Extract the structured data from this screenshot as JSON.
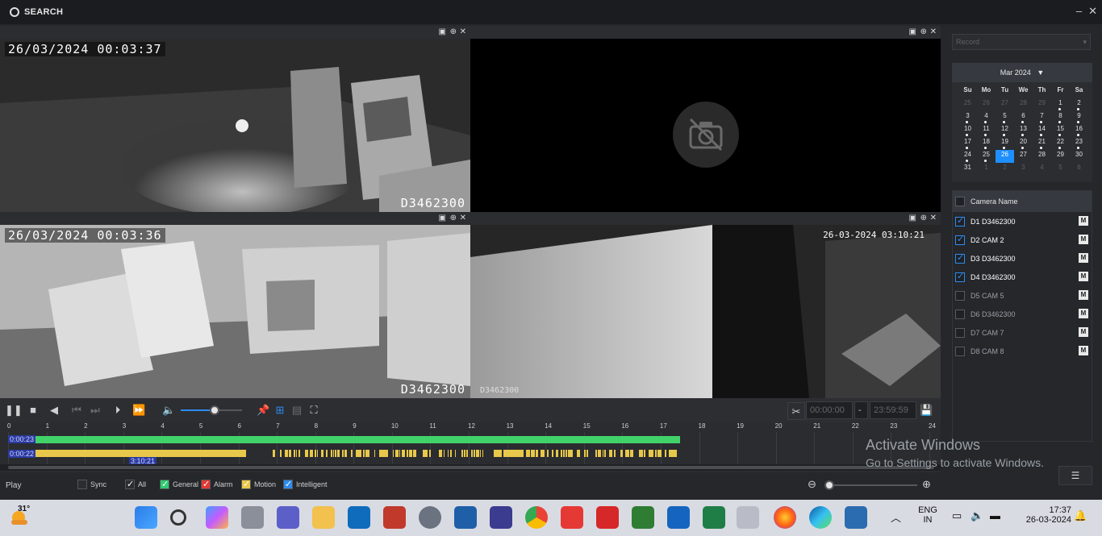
{
  "window": {
    "title": "SEARCH",
    "minimize": "–",
    "close": "✕"
  },
  "tiles": [
    {
      "timestamp": "26/03/2024 00:03:37",
      "name": "D3462300"
    },
    {
      "timestamp": "",
      "name": ""
    },
    {
      "timestamp": "26/03/2024 00:03:36",
      "name": "D3462300"
    },
    {
      "timestamp": "26-03-2024 03:10:21",
      "name": "D3462300"
    }
  ],
  "controls": {
    "start_time": "00:00:00",
    "separator": "-",
    "end_time": "23:59:59",
    "volume_level": 0.55
  },
  "timeline": {
    "hours": [
      "0",
      "1",
      "2",
      "3",
      "4",
      "5",
      "6",
      "7",
      "8",
      "9",
      "10",
      "11",
      "12",
      "13",
      "14",
      "15",
      "16",
      "17",
      "18",
      "19",
      "20",
      "21",
      "22",
      "23",
      "24"
    ],
    "track1_label": "0:00:23",
    "track2_label": "0:00:22",
    "cursor_label": "3:10:21"
  },
  "status": {
    "mode": "Play",
    "legend": [
      {
        "label": "Sync",
        "checked": false,
        "color": "#2b2d31"
      },
      {
        "label": "All",
        "checked": true,
        "color": "#2b2d31"
      },
      {
        "label": "General",
        "checked": true,
        "color": "#2ecc71"
      },
      {
        "label": "Alarm",
        "checked": true,
        "color": "#e53935"
      },
      {
        "label": "Motion",
        "checked": true,
        "color": "#e8c84a"
      },
      {
        "label": "Intelligent",
        "checked": true,
        "color": "#2d8cf0"
      }
    ]
  },
  "right": {
    "record_placeholder": "Record",
    "calendar": {
      "month": "Mar 2024",
      "weekdays": [
        "Su",
        "Mo",
        "Tu",
        "We",
        "Th",
        "Fr",
        "Sa"
      ],
      "days": [
        {
          "d": "25",
          "m": true
        },
        {
          "d": "26",
          "m": true
        },
        {
          "d": "27",
          "m": true
        },
        {
          "d": "28",
          "m": true
        },
        {
          "d": "29",
          "m": true
        },
        {
          "d": "1",
          "dot": true
        },
        {
          "d": "2",
          "dot": true
        },
        {
          "d": "3",
          "dot": true
        },
        {
          "d": "4",
          "dot": true
        },
        {
          "d": "5",
          "dot": true
        },
        {
          "d": "6",
          "dot": true
        },
        {
          "d": "7",
          "dot": true
        },
        {
          "d": "8",
          "dot": true
        },
        {
          "d": "9",
          "dot": true
        },
        {
          "d": "10",
          "dot": true
        },
        {
          "d": "11",
          "dot": true
        },
        {
          "d": "12",
          "dot": true
        },
        {
          "d": "13",
          "dot": true
        },
        {
          "d": "14",
          "dot": true
        },
        {
          "d": "15",
          "dot": true
        },
        {
          "d": "16",
          "dot": true
        },
        {
          "d": "17",
          "dot": true
        },
        {
          "d": "18",
          "dot": true
        },
        {
          "d": "19",
          "dot": true
        },
        {
          "d": "20",
          "dot": true
        },
        {
          "d": "21",
          "dot": true
        },
        {
          "d": "22",
          "dot": true
        },
        {
          "d": "23",
          "dot": true
        },
        {
          "d": "24",
          "dot": true
        },
        {
          "d": "25",
          "dot": true
        },
        {
          "d": "26",
          "sel": true
        },
        {
          "d": "27"
        },
        {
          "d": "28"
        },
        {
          "d": "29"
        },
        {
          "d": "30"
        },
        {
          "d": "31"
        },
        {
          "d": "1",
          "m": true
        },
        {
          "d": "2",
          "m": true
        },
        {
          "d": "3",
          "m": true
        },
        {
          "d": "4",
          "m": true
        },
        {
          "d": "5",
          "m": true
        },
        {
          "d": "6",
          "m": true
        }
      ]
    },
    "camera_header": "Camera Name",
    "cameras": [
      {
        "name": "D1 D3462300",
        "checked": true
      },
      {
        "name": "D2 CAM 2",
        "checked": true
      },
      {
        "name": "D3 D3462300",
        "checked": true
      },
      {
        "name": "D4 D3462300",
        "checked": true
      },
      {
        "name": "D5 CAM 5",
        "checked": false
      },
      {
        "name": "D6 D3462300",
        "checked": false
      },
      {
        "name": "D7 CAM 7",
        "checked": false
      },
      {
        "name": "D8 CAM 8",
        "checked": false
      }
    ],
    "m_label": "M"
  },
  "watermark": {
    "line1": "Activate Windows",
    "line2": "Go to Settings to activate Windows."
  },
  "taskbar": {
    "temperature": "31°",
    "language": "ENG",
    "region": "IN",
    "time": "17:37",
    "date": "26-03-2024"
  }
}
